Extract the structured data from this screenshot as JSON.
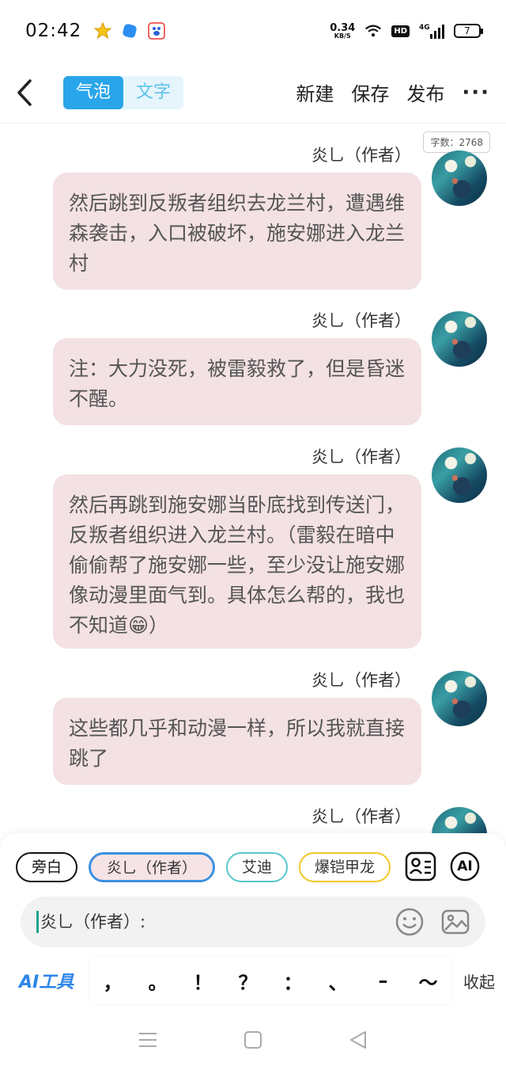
{
  "status_bar": {
    "time": "02:42",
    "net_speed_value": "0.34",
    "net_speed_unit": "KB/S",
    "hd": "HD",
    "signal": "4G",
    "battery": "7"
  },
  "header": {
    "tabs": [
      {
        "label": "气泡",
        "active": true
      },
      {
        "label": "文字",
        "active": false
      }
    ],
    "new_label": "新建",
    "save_label": "保存",
    "publish_label": "发布",
    "more_label": "···"
  },
  "word_count": "字数：2768",
  "messages": [
    {
      "name": "炎乚（作者）",
      "text": "然后跳到反叛者组织去龙兰村，遭遇维森袭击，入口被破坏，施安娜进入龙兰村"
    },
    {
      "name": "炎乚（作者）",
      "text": "注：大力没死，被雷毅救了，但是昏迷不醒。"
    },
    {
      "name": "炎乚（作者）",
      "text": "然后再跳到施安娜当卧底找到传送门，反叛者组织进入龙兰村。（雷毅在暗中偷偷帮了施安娜一些，至少没让施安娜像动漫里面气到。具体怎么帮的，我也不知道😁）"
    },
    {
      "name": "炎乚（作者）",
      "text": "这些都几乎和动漫一样，所以我就直接跳了"
    },
    {
      "name": "炎乚（作者）",
      "text": ""
    }
  ],
  "composer": {
    "roles": [
      "旁白",
      "炎乚（作者）",
      "艾迪",
      "爆铠甲龙"
    ],
    "ai_label": "AI",
    "input_value": "炎乚（作者）:",
    "ai_tools_label": "AI工具",
    "punctuation": [
      "，",
      "。",
      "！",
      "？",
      "：",
      "、",
      "–",
      "～"
    ],
    "collapse_label": "收起"
  },
  "colors": {
    "accent": "#29a6ea",
    "bubble": "#f3e1e3",
    "selected_role_border": "#3d8fe0"
  }
}
